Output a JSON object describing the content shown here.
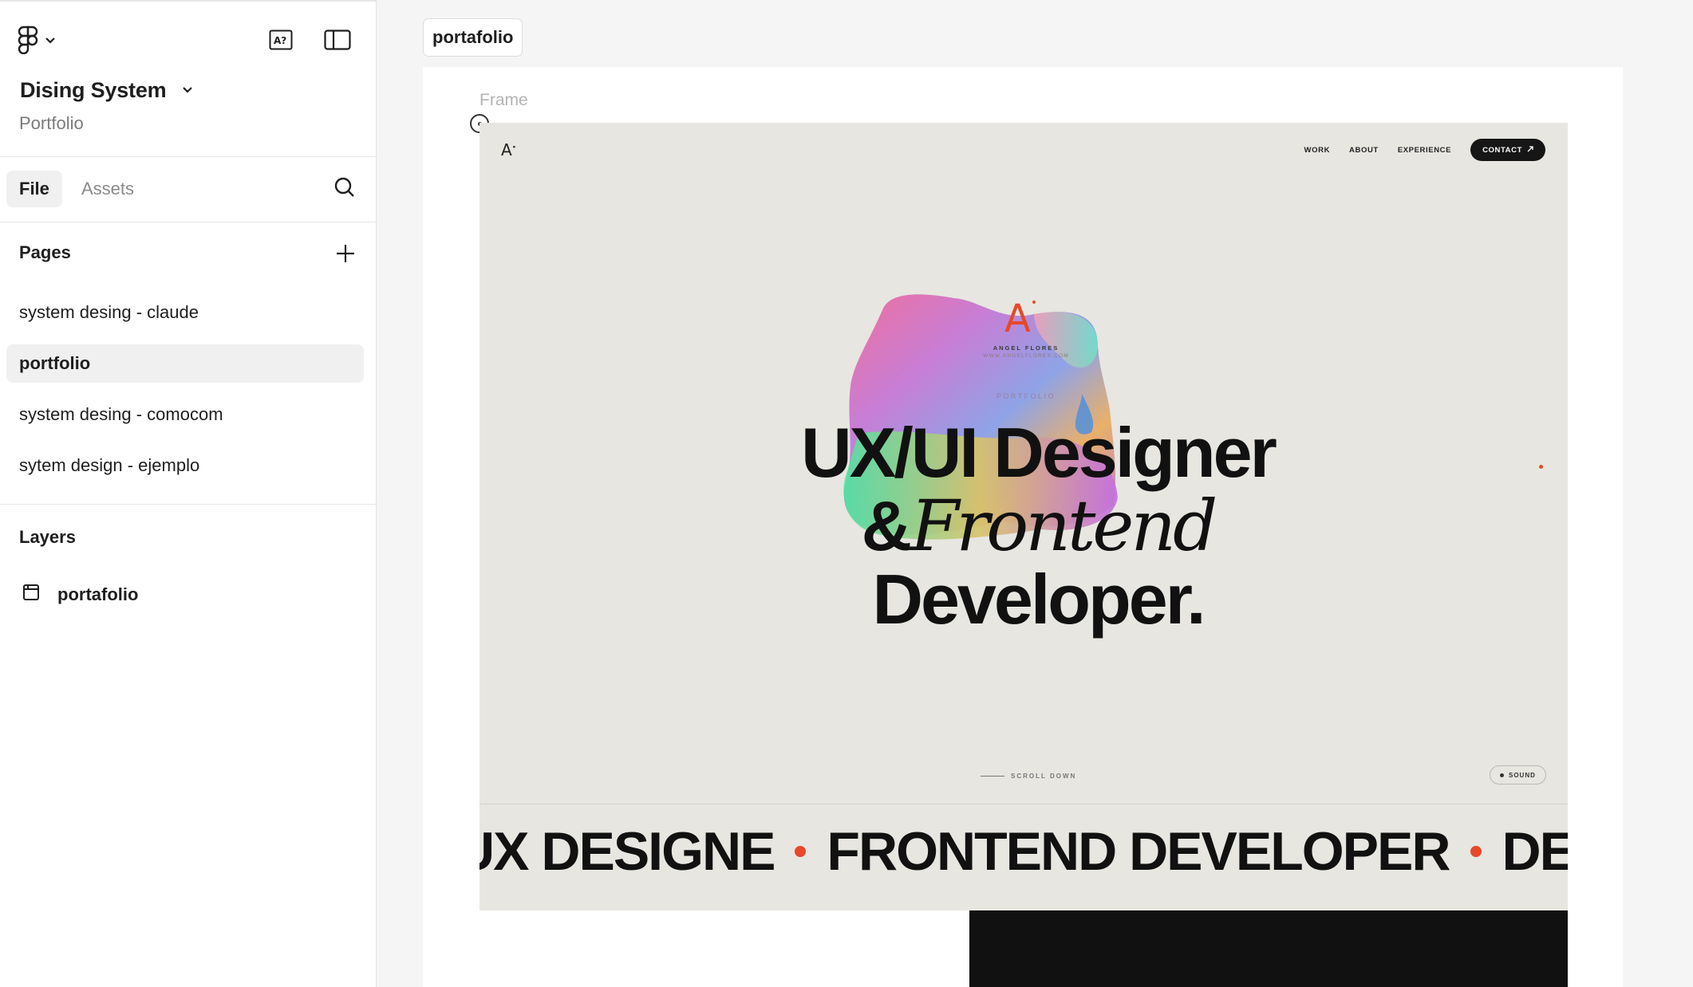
{
  "sidebar": {
    "file_title": "Dising System",
    "file_subtitle": "Portfolio",
    "tabs": [
      {
        "label": "File"
      },
      {
        "label": "Assets"
      }
    ],
    "pages_heading": "Pages",
    "pages": [
      {
        "label": "system desing - claude"
      },
      {
        "label": "portfolio"
      },
      {
        "label": "system desing - comocom"
      },
      {
        "label": "sytem design - ejemplo"
      }
    ],
    "layers_heading": "Layers",
    "layers": [
      {
        "label": "portafolio"
      }
    ]
  },
  "canvas": {
    "page_chip": "portafolio",
    "frame_label": "Frame"
  },
  "frame": {
    "logo": "A",
    "nav": [
      "WORK",
      "ABOUT",
      "EXPERIENCE"
    ],
    "contact": "CONTACT",
    "brand_name": "ANGEL FLORES",
    "brand_url": "WWW.ANGELFLORES.COM",
    "kicker": "PORTFOLIO",
    "hero_line1": "UX/UI Designer",
    "hero_amp": "&",
    "hero_italic": "Frontend",
    "hero_line3": "Developer.",
    "scroll": "SCROLL DOWN",
    "sound": "SOUND",
    "marquee": [
      "UX DESIGNE",
      "FRONTEND DEVELOPER",
      "DESIG"
    ]
  },
  "colors": {
    "accent": "#e8472a",
    "frame_bg": "#e7e6e1",
    "ink": "#111111"
  }
}
